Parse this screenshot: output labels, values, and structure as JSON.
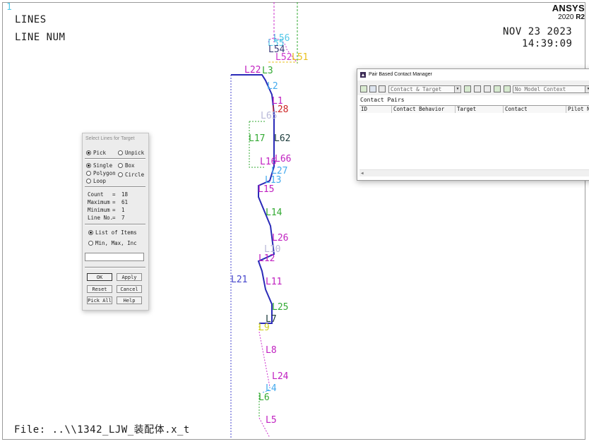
{
  "viewport": {
    "window_number": "1",
    "plot_title": "LINES",
    "numbering": "LINE NUM",
    "date": "NOV 23 2023",
    "time": "14:39:09",
    "file": "File: ..\\\\1342_LJW_装配体.x_t",
    "brand": "ANSYS",
    "version_prefix": "2020",
    "version_suffix": "R2"
  },
  "line_labels": [
    {
      "text": "L56",
      "color": "#55c8e8"
    },
    {
      "text": "L55",
      "color": "#55c8e8"
    },
    {
      "text": "L54",
      "color": "#3a3a7a"
    },
    {
      "text": "L52",
      "color": "#cc33cc"
    },
    {
      "text": "L51",
      "color": "#e8c020"
    },
    {
      "text": "L22",
      "color": "#c020c0"
    },
    {
      "text": "L3",
      "color": "#33aa33"
    },
    {
      "text": "L2",
      "color": "#44aaee"
    },
    {
      "text": "L1",
      "color": "#c020c0"
    },
    {
      "text": "L28",
      "color": "#cc2222"
    },
    {
      "text": "L65",
      "color": "#b8b8d8"
    },
    {
      "text": "L17",
      "color": "#33aa33"
    },
    {
      "text": "L62",
      "color": "#1a3a3a"
    },
    {
      "text": "L16",
      "color": "#c020c0"
    },
    {
      "text": "L66",
      "color": "#c020c0"
    },
    {
      "text": "L27",
      "color": "#44aaee"
    },
    {
      "text": "L13",
      "color": "#44aaee"
    },
    {
      "text": "L15",
      "color": "#c020c0"
    },
    {
      "text": "L14",
      "color": "#33aa33"
    },
    {
      "text": "L26",
      "color": "#c020c0"
    },
    {
      "text": "L10",
      "color": "#b8b8d8"
    },
    {
      "text": "L12",
      "color": "#c020c0"
    },
    {
      "text": "L21",
      "color": "#4444cc"
    },
    {
      "text": "L11",
      "color": "#c020c0"
    },
    {
      "text": "L25",
      "color": "#33aa33"
    },
    {
      "text": "L7",
      "color": "#1a3a3a"
    },
    {
      "text": "L9",
      "color": "#d0d020"
    },
    {
      "text": "L8",
      "color": "#c020c0"
    },
    {
      "text": "L24",
      "color": "#c020c0"
    },
    {
      "text": "L4",
      "color": "#44aaee"
    },
    {
      "text": "L6",
      "color": "#33aa33"
    },
    {
      "text": "L5",
      "color": "#c020c0"
    }
  ],
  "pick_dialog": {
    "title": "Select Lines for Target",
    "pick": "Pick",
    "unpick": "Unpick",
    "single": "Single",
    "box": "Box",
    "polygon": "Polygon",
    "circle": "Circle",
    "loop": "Loop",
    "count_label": "Count",
    "count_value": "18",
    "maximum_label": "Maximum",
    "maximum_value": "61",
    "minimum_label": "Minimum",
    "minimum_value": "1",
    "lineno_label": "Line No.",
    "lineno_value": "7",
    "eq": "=",
    "list_of_items": "List of Items",
    "min_max_inc": "Min, Max, Inc",
    "input_value": "",
    "ok": "OK",
    "apply": "Apply",
    "reset": "Reset",
    "cancel": "Cancel",
    "pick_all": "Pick All",
    "help": "Help"
  },
  "contact_manager": {
    "title": "Pair Based Contact Manager",
    "contact_target_combo": "Contact & Target",
    "model_context_combo": "No Model Context",
    "section": "Contact Pairs",
    "columns": [
      "ID",
      "Contact Behavior",
      "Target",
      "Contact",
      "Pilot Node"
    ]
  }
}
